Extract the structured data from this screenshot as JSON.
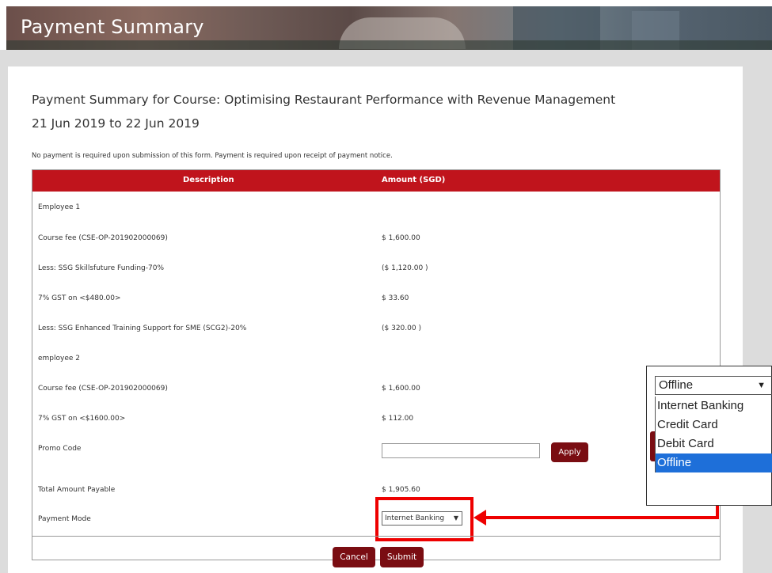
{
  "banner": {
    "title": "Payment Summary"
  },
  "summary": {
    "heading": "Payment Summary for Course: Optimising Restaurant Performance with Revenue Management",
    "dates": "21 Jun 2019 to 22 Jun 2019",
    "note": "No payment is required upon submission of this form. Payment is required upon receipt of payment notice."
  },
  "table": {
    "headers": {
      "description": "Description",
      "amount": "Amount (SGD)"
    },
    "rows": [
      {
        "label": "Employee 1",
        "amount": ""
      },
      {
        "label": "Course fee (CSE-OP-201902000069)",
        "amount": "$ 1,600.00"
      },
      {
        "label": "Less: SSG Skillsfuture Funding-70%",
        "amount": "($ 1,120.00 )"
      },
      {
        "label": "7% GST on <$480.00>",
        "amount": "$ 33.60"
      },
      {
        "label": "Less: SSG Enhanced Training Support for SME (SCG2)-20%",
        "amount": "($ 320.00 )"
      },
      {
        "label": "employee 2",
        "amount": ""
      },
      {
        "label": "Course fee (CSE-OP-201902000069)",
        "amount": "$ 1,600.00"
      },
      {
        "label": "7% GST on <$1600.00>",
        "amount": "$ 112.00"
      }
    ],
    "promo": {
      "label": "Promo Code",
      "value": "",
      "apply_label": "Apply"
    },
    "total": {
      "label": "Total Amount Payable",
      "amount": "$ 1,905.60"
    },
    "payment_mode": {
      "label": "Payment Mode",
      "selected": "Internet Banking"
    }
  },
  "actions": {
    "cancel_label": "Cancel",
    "submit_label": "Submit"
  },
  "popup": {
    "current": "Offline",
    "options": [
      "Internet Banking",
      "Credit Card",
      "Debit Card",
      "Offline"
    ],
    "highlighted": "Offline"
  },
  "icons": {
    "caret": "caret-down-icon",
    "arrow": "arrow-left-icon"
  },
  "colors": {
    "header_red": "#c0141c",
    "button_maroon": "#7a0d12",
    "annotation_red": "#ee0000",
    "highlight_blue": "#1e6fd9"
  }
}
